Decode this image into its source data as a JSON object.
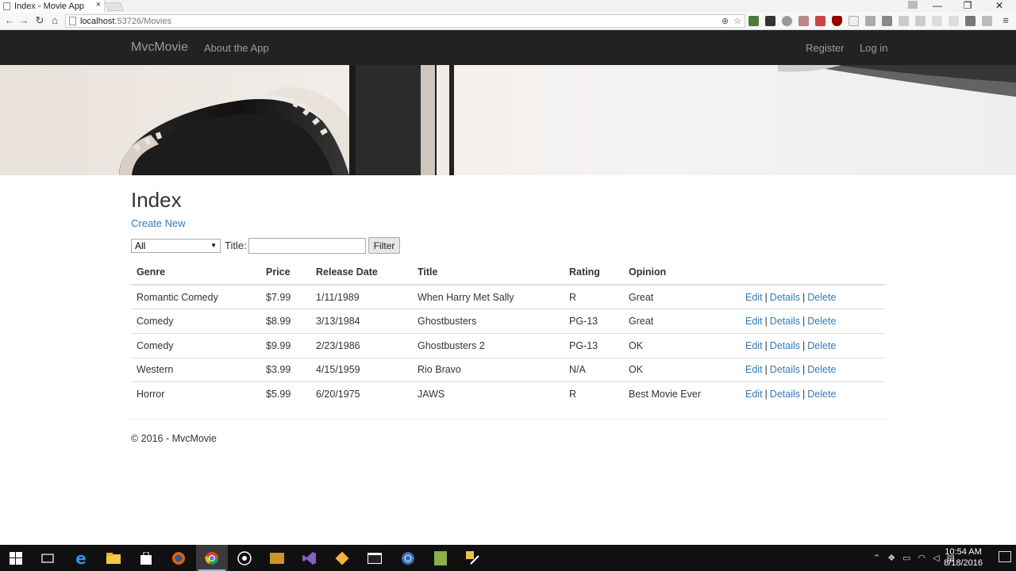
{
  "browser": {
    "tab_title": "Index - Movie App",
    "tab_close": "×",
    "url_host": "localhost",
    "url_path": ":53726/Movies",
    "window_controls": {
      "minimize": "—",
      "maximize": "❐",
      "close": "✕"
    }
  },
  "navbar": {
    "brand": "MvcMovie",
    "left_links": [
      "About the App"
    ],
    "right_links": [
      "Register",
      "Log in"
    ]
  },
  "page": {
    "title": "Index",
    "create_new": "Create New",
    "filter": {
      "genre_selected": "All",
      "title_label": "Title:",
      "title_value": "",
      "button": "Filter"
    },
    "table": {
      "headers": [
        "Genre",
        "Price",
        "Release Date",
        "Title",
        "Rating",
        "Opinion",
        ""
      ],
      "rows": [
        {
          "genre": "Romantic Comedy",
          "price": "$7.99",
          "release": "1/11/1989",
          "title": "When Harry Met Sally",
          "rating": "R",
          "opinion": "Great"
        },
        {
          "genre": "Comedy",
          "price": "$8.99",
          "release": "3/13/1984",
          "title": "Ghostbusters",
          "rating": "PG-13",
          "opinion": "Great"
        },
        {
          "genre": "Comedy",
          "price": "$9.99",
          "release": "2/23/1986",
          "title": "Ghostbusters 2",
          "rating": "PG-13",
          "opinion": "OK"
        },
        {
          "genre": "Western",
          "price": "$3.99",
          "release": "4/15/1959",
          "title": "Rio Bravo",
          "rating": "N/A",
          "opinion": "OK"
        },
        {
          "genre": "Horror",
          "price": "$5.99",
          "release": "6/20/1975",
          "title": "JAWS",
          "rating": "R",
          "opinion": "Best Movie Ever"
        }
      ],
      "actions": {
        "edit": "Edit",
        "details": "Details",
        "delete": "Delete",
        "separator": "|"
      }
    },
    "footer": "© 2016 - MvcMovie"
  },
  "taskbar": {
    "time": "10:54 AM",
    "date": "8/18/2016"
  },
  "colors": {
    "navbar_bg": "#222222",
    "navbar_text": "#9d9d9d",
    "link": "#337ab7",
    "taskbar_bg": "#101010"
  }
}
